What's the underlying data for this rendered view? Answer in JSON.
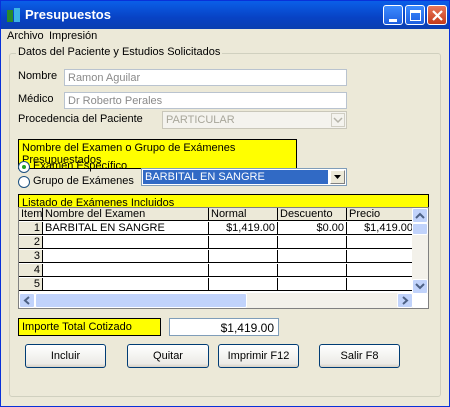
{
  "window": {
    "title": "Presupuestos"
  },
  "menu": {
    "items": [
      "Archivo",
      "Impresión"
    ]
  },
  "group": {
    "title": "Datos del Paciente y Estudios Solicitados"
  },
  "patient": {
    "name_label": "Nombre",
    "name_value": "Ramon Aguilar",
    "doctor_label": "Médico",
    "doctor_value": "Dr Roberto Perales",
    "origin_label": "Procedencia del Paciente",
    "origin_value": "PARTICULAR"
  },
  "exam_section": {
    "header": "Nombre del Examen o Grupo de Exámenes Presupuestados",
    "radio_specific": "Examen Específico",
    "radio_group": "Grupo de Exámenes",
    "selected_exam": "BARBITAL EN SANGRE"
  },
  "exams_list": {
    "header": "Listado de Exámenes Incluidos",
    "columns": [
      "Item",
      "Nombre del Examen",
      "Normal",
      "Descuento",
      "Precio"
    ],
    "rows": [
      {
        "item": "1",
        "name": "BARBITAL EN SANGRE",
        "normal": "$1,419.00",
        "discount": "$0.00",
        "price": "$1,419.00"
      },
      {
        "item": "2",
        "name": "",
        "normal": "",
        "discount": "",
        "price": ""
      },
      {
        "item": "3",
        "name": "",
        "normal": "",
        "discount": "",
        "price": ""
      },
      {
        "item": "4",
        "name": "",
        "normal": "",
        "discount": "",
        "price": ""
      },
      {
        "item": "5",
        "name": "",
        "normal": "",
        "discount": "",
        "price": ""
      }
    ]
  },
  "total": {
    "label": "Importe Total Cotizado",
    "value": "$1,419.00"
  },
  "buttons": {
    "include": "Incluir",
    "remove": "Quitar",
    "print": "Imprimir   F12",
    "exit": "Salir   F8"
  },
  "icons": {
    "app": "app-icon",
    "minimize": "minimize-icon",
    "maximize": "maximize-icon",
    "close": "close-icon"
  }
}
